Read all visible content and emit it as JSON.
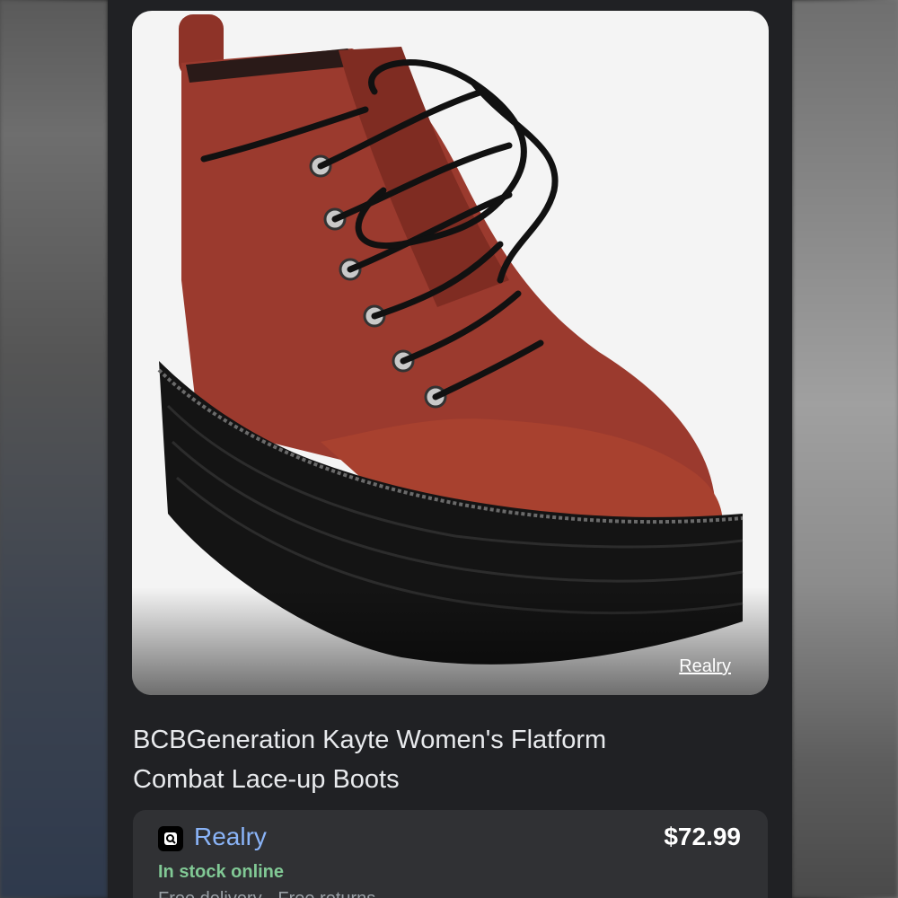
{
  "product": {
    "image_source_link": "Realry",
    "title_line1": "BCBGeneration Kayte Women's Flatform",
    "title_line2": "Combat Lace-up Boots"
  },
  "offer": {
    "merchant_icon": "merchant-logo-icon",
    "merchant_name": "Realry",
    "price": "$72.99",
    "stock_status": "In stock online",
    "delivery_text": "Free delivery · Free returns"
  },
  "colors": {
    "panel_bg": "#202124",
    "offer_card_bg": "#303134",
    "link_blue": "#8ab4f8",
    "stock_green": "#81c995",
    "boot_leather": "#9b3a2e"
  }
}
